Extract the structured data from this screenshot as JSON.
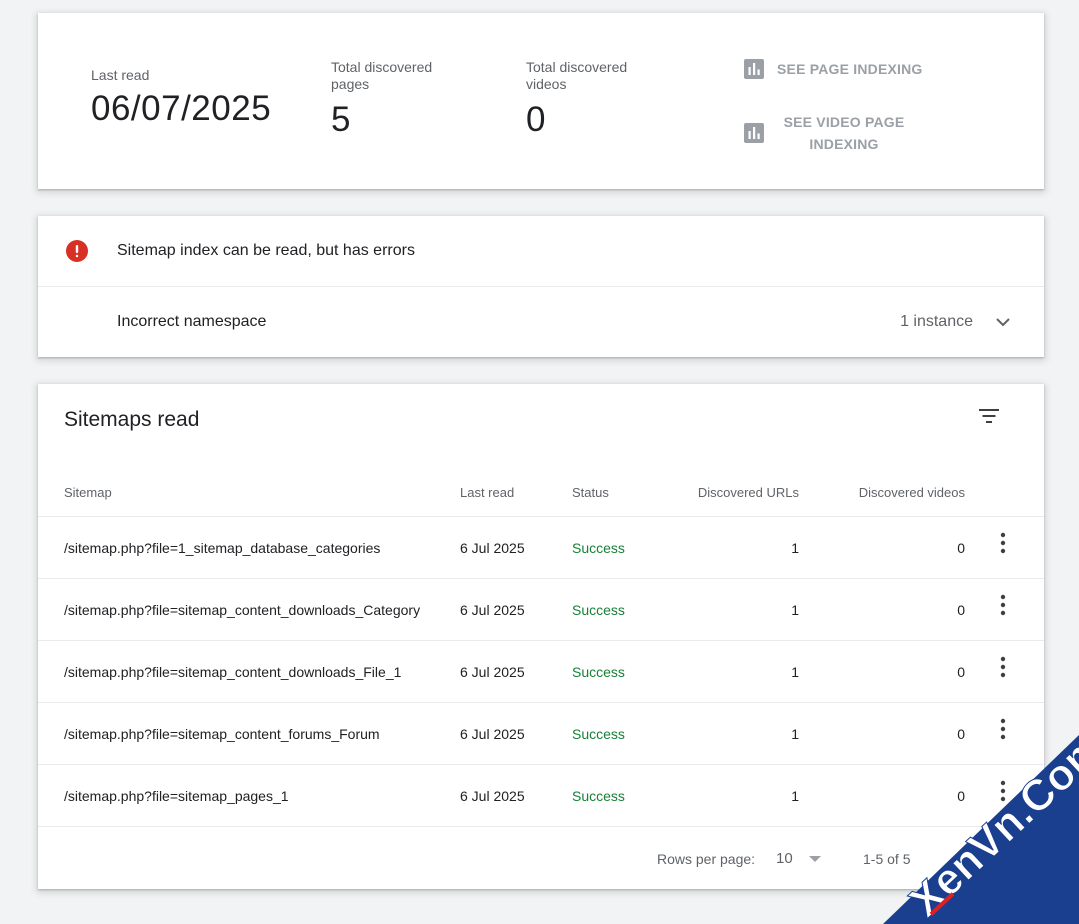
{
  "summary": {
    "last_read_label": "Last read",
    "last_read_value": "06/07/2025",
    "pages_label": "Total discovered pages",
    "pages_value": "5",
    "videos_label": "Total discovered videos",
    "videos_value": "0",
    "see_page_indexing": "SEE PAGE INDEXING",
    "see_video_indexing": "SEE VIDEO PAGE INDEXING"
  },
  "errors": {
    "header": "Sitemap index can be read, but has errors",
    "item_label": "Incorrect namespace",
    "item_count": "1 instance"
  },
  "sitemaps": {
    "title": "Sitemaps read",
    "columns": {
      "sitemap": "Sitemap",
      "last_read": "Last read",
      "status": "Status",
      "urls": "Discovered URLs",
      "videos": "Discovered videos"
    },
    "rows": [
      {
        "sitemap": "/sitemap.php?file=1_sitemap_database_categories",
        "last_read": "6 Jul 2025",
        "status": "Success",
        "urls": "1",
        "videos": "0"
      },
      {
        "sitemap": "/sitemap.php?file=sitemap_content_downloads_Category",
        "last_read": "6 Jul 2025",
        "status": "Success",
        "urls": "1",
        "videos": "0"
      },
      {
        "sitemap": "/sitemap.php?file=sitemap_content_downloads_File_1",
        "last_read": "6 Jul 2025",
        "status": "Success",
        "urls": "1",
        "videos": "0"
      },
      {
        "sitemap": "/sitemap.php?file=sitemap_content_forums_Forum",
        "last_read": "6 Jul 2025",
        "status": "Success",
        "urls": "1",
        "videos": "0"
      },
      {
        "sitemap": "/sitemap.php?file=sitemap_pages_1",
        "last_read": "6 Jul 2025",
        "status": "Success",
        "urls": "1",
        "videos": "0"
      }
    ],
    "pager": {
      "rows_per_page_label": "Rows per page:",
      "rows_per_page_value": "10",
      "range": "1-5 of 5"
    }
  },
  "watermark": {
    "text": "XenVn.Com"
  },
  "colors": {
    "success": "#188038",
    "error": "#d93025",
    "muted": "#9aa0a6",
    "watermark": "#1a3f8f"
  },
  "icons": {
    "chart": "bar-chart-icon",
    "error": "error-circle-icon",
    "expand": "chevron-down-icon",
    "filter": "filter-icon",
    "more": "more-vert-icon",
    "next": "chevron-right-icon"
  }
}
